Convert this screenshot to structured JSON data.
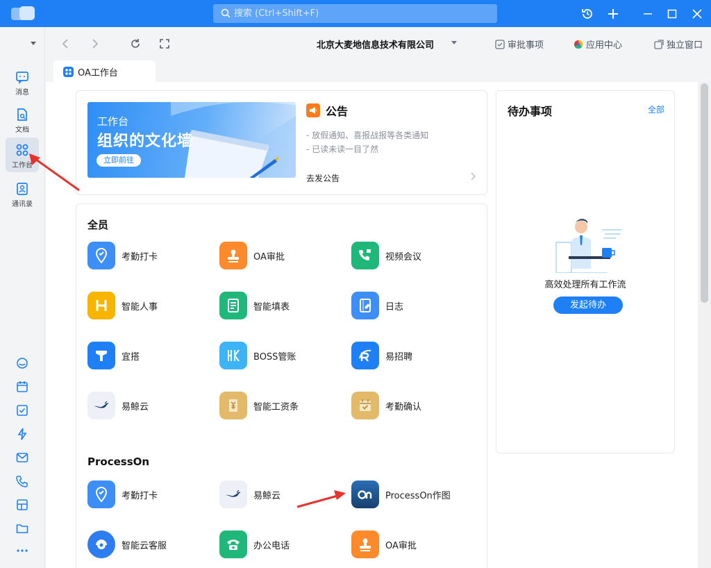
{
  "titlebar": {
    "search_placeholder": "搜索 (Ctrl+Shift+F)"
  },
  "rail": {
    "items": [
      {
        "label": "消息",
        "icon": "message-icon"
      },
      {
        "label": "文档",
        "icon": "document-icon"
      },
      {
        "label": "工作台",
        "icon": "workbench-icon",
        "active": true
      },
      {
        "label": "通讯录",
        "icon": "contacts-icon"
      }
    ]
  },
  "toolbar": {
    "org_name": "北京大麦地信息技术有限公司",
    "approval": "审批事项",
    "app_center": "应用中心",
    "standalone": "独立窗口"
  },
  "tab": {
    "label": "OA工作台"
  },
  "banner": {
    "line1": "工作台",
    "line2": "组织的文化墙",
    "button": "立即前往"
  },
  "notice": {
    "title": "公告",
    "line1": "- 放假通知、喜报战报等各类通知",
    "line2": "- 已读未读一目了然",
    "go": "去发公告"
  },
  "sections": [
    {
      "title": "全员",
      "apps": [
        {
          "label": "考勤打卡",
          "color": "#3d8ef7"
        },
        {
          "label": "OA审批",
          "color": "#ff8a2b"
        },
        {
          "label": "视频会议",
          "color": "#1fb87a"
        },
        {
          "label": "智能人事",
          "color": "#f7b500"
        },
        {
          "label": "智能填表",
          "color": "#1fb87a"
        },
        {
          "label": "日志",
          "color": "#3d8ef7"
        },
        {
          "label": "宜搭",
          "color": "#1f7ff5"
        },
        {
          "label": "BOSS管账",
          "color": "#3db4f5"
        },
        {
          "label": "易招聘",
          "color": "#1f7ff5"
        },
        {
          "label": "易鲸云",
          "color": "#eef0f7"
        },
        {
          "label": "智能工资条",
          "color": "#e3b96a"
        },
        {
          "label": "考勤确认",
          "color": "#e3b96a"
        }
      ]
    },
    {
      "title": "ProcessOn",
      "apps": [
        {
          "label": "考勤打卡",
          "color": "#3d8ef7"
        },
        {
          "label": "易鲸云",
          "color": "#eef0f7"
        },
        {
          "label": "ProcessOn作图",
          "color": "#1d4f86"
        },
        {
          "label": "智能云客服",
          "color": "#2d7df0"
        },
        {
          "label": "办公电话",
          "color": "#1fb87a"
        },
        {
          "label": "OA审批",
          "color": "#ff8a2b"
        }
      ]
    }
  ],
  "todo": {
    "title": "待办事项",
    "all": "全部",
    "desc": "高效处理所有工作流",
    "button": "发起待办"
  },
  "colors": {
    "brand": "#1f7ff5",
    "annotation_arrow": "#e8322d"
  }
}
